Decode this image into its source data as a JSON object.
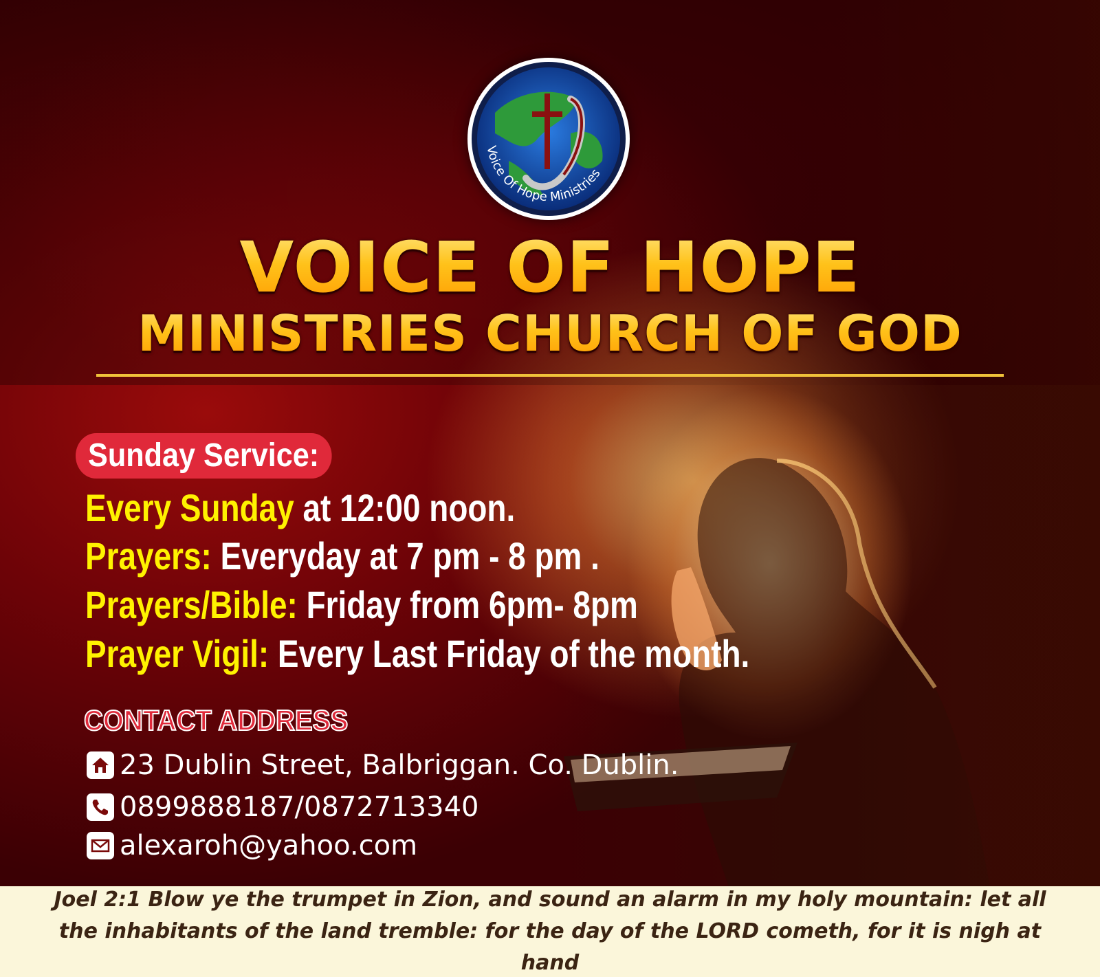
{
  "logo": {
    "ring_text": "Voice Of Hope Ministries",
    "icon": "globe-cross-logo"
  },
  "title": {
    "line1": "VOICE OF HOPE",
    "line2": "MINISTRIES CHURCH OF GOD"
  },
  "schedule": {
    "badge": "Sunday Service:",
    "items": [
      {
        "label": "Every Sunday",
        "text": " at 12:00 noon."
      },
      {
        "label": "Prayers:",
        "text": " Everyday at 7 pm - 8 pm ."
      },
      {
        "label": "Prayers/Bible:",
        "text": " Friday from 6pm- 8pm"
      },
      {
        "label": "Prayer Vigil:",
        "text": " Every Last Friday of the month."
      }
    ]
  },
  "contact": {
    "heading": "CONTACT ADDRESS",
    "address": "23 Dublin Street, Balbriggan. Co. Dublin.",
    "phone": "0899888187/0872713340",
    "email": "alexaroh@yahoo.com",
    "icons": [
      "home-icon",
      "phone-icon",
      "mail-icon"
    ]
  },
  "footer": {
    "verse": "Joel 2:1 Blow ye the trumpet in Zion, and sound an alarm in my holy mountain: let all the inhabitants of the land tremble: for the day of the LORD cometh, for it is nigh at hand"
  },
  "colors": {
    "background": "#6e0307",
    "title_gold": "#ffc21a",
    "highlight_yellow": "#fff200",
    "badge_red": "#e0293a",
    "footer_bg": "#fbf6da"
  }
}
